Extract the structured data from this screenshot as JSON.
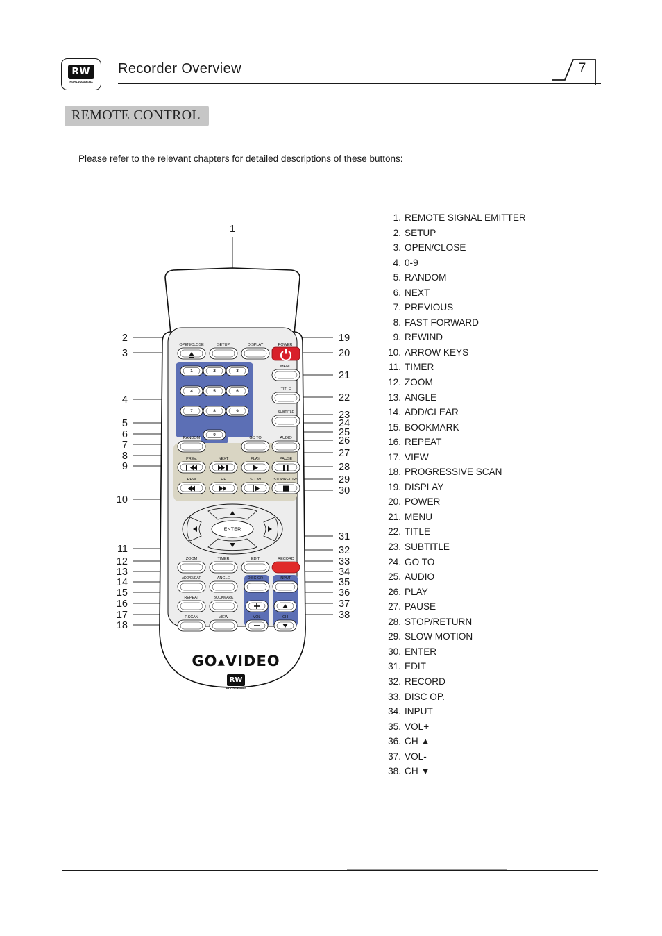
{
  "header": {
    "title": "Recorder Overview",
    "page_number": "7",
    "logo_text": "RW",
    "logo_sub": "DVD+ReWritable"
  },
  "section": {
    "title": "REMOTE CONTROL"
  },
  "intro": {
    "text": "Please refer to the relevant chapters for detailed descriptions of these buttons:"
  },
  "legend": {
    "items": [
      {
        "num": "1.",
        "label": "REMOTE SIGNAL EMITTER"
      },
      {
        "num": "2.",
        "label": "SETUP"
      },
      {
        "num": "3.",
        "label": "OPEN/CLOSE"
      },
      {
        "num": "4.",
        "label": "0-9"
      },
      {
        "num": "5.",
        "label": "RANDOM"
      },
      {
        "num": "6.",
        "label": "NEXT"
      },
      {
        "num": "7.",
        "label": "PREVIOUS"
      },
      {
        "num": "8.",
        "label": "FAST FORWARD"
      },
      {
        "num": "9.",
        "label": "REWIND"
      },
      {
        "num": "10.",
        "label": "ARROW KEYS"
      },
      {
        "num": "11.",
        "label": "TIMER"
      },
      {
        "num": "12.",
        "label": "ZOOM"
      },
      {
        "num": "13.",
        "label": "ANGLE"
      },
      {
        "num": "14.",
        "label": "ADD/CLEAR"
      },
      {
        "num": "15.",
        "label": "BOOKMARK"
      },
      {
        "num": "16.",
        "label": "REPEAT"
      },
      {
        "num": "17.",
        "label": "VIEW"
      },
      {
        "num": "18.",
        "label": "PROGRESSIVE SCAN"
      },
      {
        "num": "19.",
        "label": "DISPLAY"
      },
      {
        "num": "20.",
        "label": "POWER"
      },
      {
        "num": "21.",
        "label": "MENU"
      },
      {
        "num": "22.",
        "label": "TITLE"
      },
      {
        "num": "23.",
        "label": "SUBTITLE"
      },
      {
        "num": "24.",
        "label": "GO TO"
      },
      {
        "num": "25.",
        "label": "AUDIO"
      },
      {
        "num": "26.",
        "label": "PLAY"
      },
      {
        "num": "27.",
        "label": "PAUSE"
      },
      {
        "num": "28.",
        "label": "STOP/RETURN"
      },
      {
        "num": "29.",
        "label": "SLOW MOTION"
      },
      {
        "num": "30.",
        "label": "ENTER"
      },
      {
        "num": "31.",
        "label": "EDIT"
      },
      {
        "num": "32.",
        "label": "RECORD"
      },
      {
        "num": "33.",
        "label": "DISC OP."
      },
      {
        "num": "34.",
        "label": "INPUT"
      },
      {
        "num": "35.",
        "label": "VOL+"
      },
      {
        "num": "36.",
        "label": "CH ▲"
      },
      {
        "num": "37.",
        "label": "VOL-"
      },
      {
        "num": "38.",
        "label": "CH ▼"
      }
    ]
  },
  "remote": {
    "brand": "GO▴VIDEO",
    "brand_rw": "RW",
    "brand_rw_sub": "DVD+ReWritable",
    "buttons": {
      "open_close": "OPEN/CLOSE",
      "setup": "SETUP",
      "display": "DISPLAY",
      "power": "POWER",
      "menu": "MENU",
      "title": "TITLE",
      "subtitle": "SUBTITLE",
      "random": "RANDOM",
      "goto": "GO TO",
      "audio": "AUDIO",
      "prev": "PREV.",
      "next": "NEXT",
      "play": "PLAY",
      "pause": "PAUSE",
      "rew": "REW",
      "ff": "F.F",
      "slow": "SLOW",
      "stop_return": "STOP/RETURN",
      "enter": "ENTER",
      "zoom": "ZOOM",
      "timer": "TIMER",
      "edit": "EDIT",
      "record": "RECORD",
      "add_clear": "ADD/CLEAR",
      "angle": "ANGLE",
      "disc_op": "DISC OP.",
      "input": "INPUT",
      "repeat": "REPEAT",
      "bookmark": "BOOKMARK",
      "pscan": "P.SCAN",
      "view": "VIEW",
      "vol": "VOL",
      "ch": "CH"
    },
    "keypad": [
      "1",
      "2",
      "3",
      "4",
      "5",
      "6",
      "7",
      "8",
      "9",
      "0"
    ],
    "callouts_left": [
      "2",
      "3",
      "4",
      "5",
      "6",
      "7",
      "8",
      "9",
      "10",
      "11",
      "12",
      "13",
      "14",
      "15",
      "16",
      "17",
      "18"
    ],
    "callouts_right": [
      "19",
      "20",
      "21",
      "22",
      "23",
      "24",
      "25",
      "26",
      "27",
      "28",
      "29",
      "30",
      "31",
      "32",
      "33",
      "34",
      "35",
      "36",
      "37",
      "38"
    ],
    "callout_top": "1",
    "colors": {
      "keypad_blue": "#5c6fb5",
      "power_red": "#d8202a",
      "record_red": "#e02a2a",
      "transport_beige": "#d9d5c3",
      "body_gray": "#ededed"
    }
  }
}
